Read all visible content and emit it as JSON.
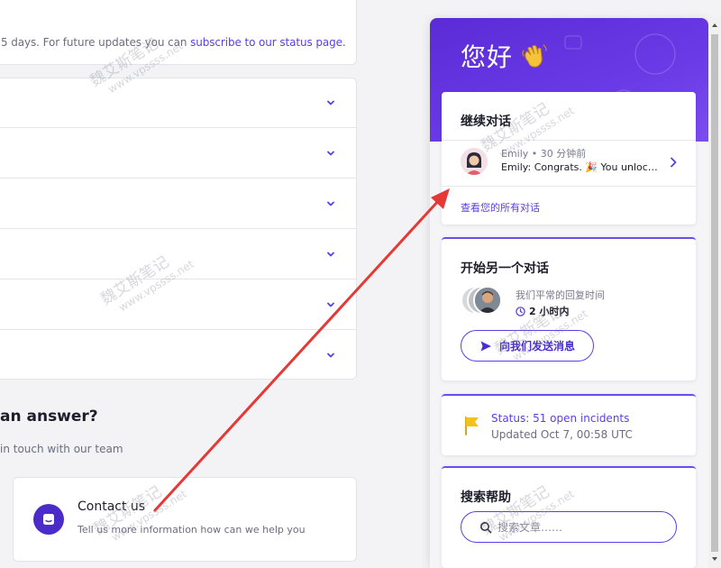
{
  "background": {
    "notice_text": "5 days. For future updates you can",
    "notice_link": "subscribe to our status page.",
    "faq_rows": 6,
    "answer_title": "an answer?",
    "answer_sub": "in touch with our team",
    "contact": {
      "title": "Contact us",
      "subtitle": "Tell us more information how can we help you"
    }
  },
  "widget": {
    "greeting": "您好",
    "continue": {
      "title": "继续对话",
      "meta": "Emily • 30 分钟前",
      "message": "Emily: Congrats. 🎉 You unlocked the new level",
      "see_all": "查看您的所有对话"
    },
    "start": {
      "title": "开始另一个对话",
      "reply_text": "我们平常的回复时间",
      "reply_time": "2 小时内",
      "send_label": "向我们发送消息"
    },
    "status": {
      "title": "Status: 51 open incidents",
      "updated": "Updated Oct 7, 00:58 UTC"
    },
    "search": {
      "title": "搜索帮助",
      "placeholder": "搜索文章……"
    }
  },
  "watermark": {
    "cn": "魏艾斯笔记",
    "url": "www.vpssss.net"
  },
  "colors": {
    "accent": "#5b3ee6",
    "header": "#6a3ae6",
    "arrow": "#e53935",
    "flag": "#f2c21b"
  }
}
